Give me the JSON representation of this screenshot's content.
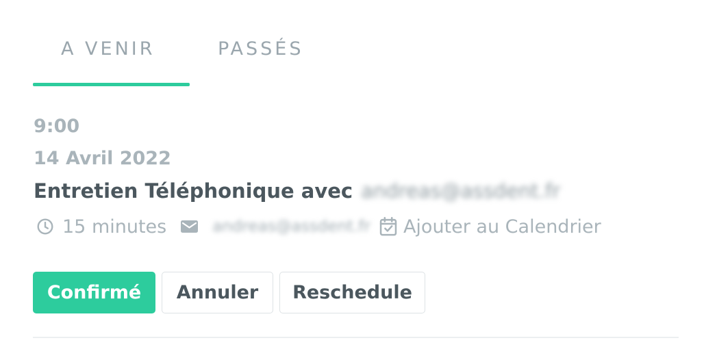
{
  "tabs": [
    {
      "label": "A VENIR",
      "active": true
    },
    {
      "label": "PASSÉS",
      "active": false
    }
  ],
  "colors": {
    "accent": "#2dcc9d",
    "muted_text": "#a9b4ba",
    "strong_text": "#4b575e",
    "border": "#dde2e5"
  },
  "appointment": {
    "time": "9:00",
    "date": "14 Avril 2022",
    "title": "Entretien Téléphonique avec",
    "title_email": "andreas@assdent.fr",
    "duration": "15 minutes",
    "email": "andreas@assdent.fr",
    "add_calendar": "Ajouter au Calendrier",
    "icons": {
      "duration": "clock-icon",
      "email": "mail-icon",
      "calendar": "calendar-check-icon"
    }
  },
  "actions": {
    "confirm": "Confirmé",
    "cancel": "Annuler",
    "reschedule": "Reschedule"
  }
}
